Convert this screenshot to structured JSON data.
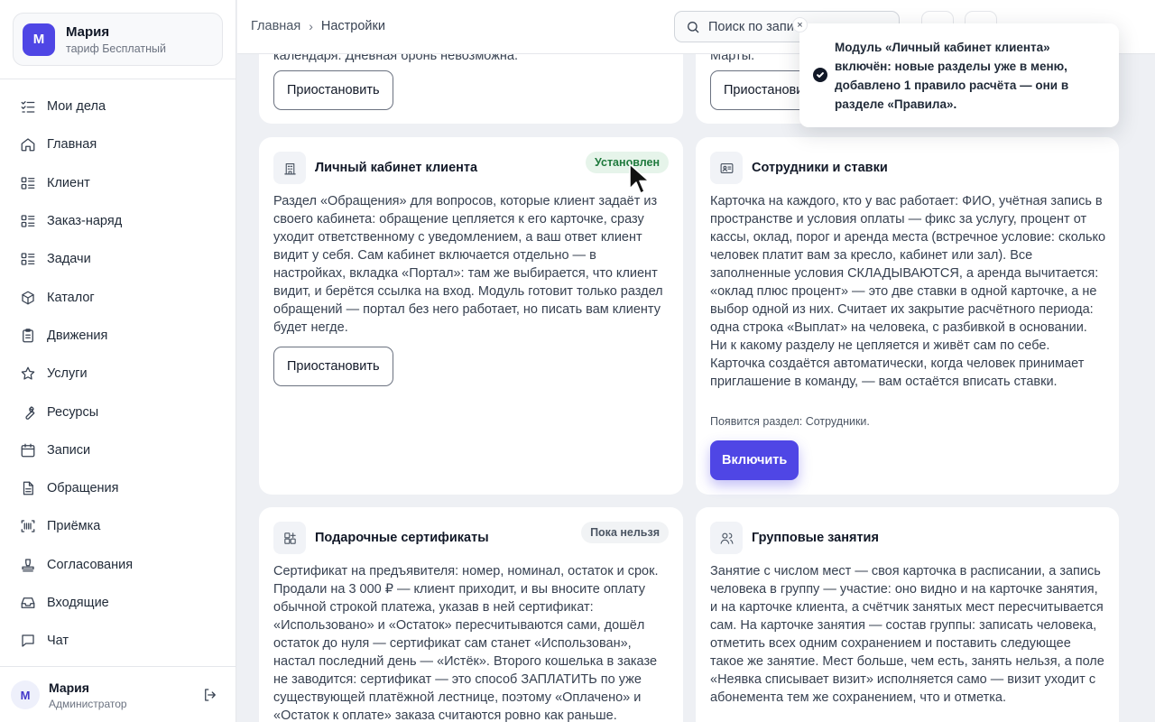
{
  "org": {
    "avatar": "М",
    "name": "Мария",
    "plan": "тариф Бесплатный"
  },
  "nav": [
    {
      "icon": "task-list-icon",
      "label": "Мои дела"
    },
    {
      "icon": "home-icon",
      "label": "Главная"
    },
    {
      "icon": "list-icon",
      "label": "Клиент"
    },
    {
      "icon": "list-icon",
      "label": "Заказ-наряд"
    },
    {
      "icon": "list-icon",
      "label": "Задачи"
    },
    {
      "icon": "box-icon",
      "label": "Каталог"
    },
    {
      "icon": "clipboard-icon",
      "label": "Движения"
    },
    {
      "icon": "star-icon",
      "label": "Услуги"
    },
    {
      "icon": "wrench-icon",
      "label": "Ресурсы"
    },
    {
      "icon": "calendar-icon",
      "label": "Записи"
    },
    {
      "icon": "document-icon",
      "label": "Обращения"
    },
    {
      "icon": "barcode-icon",
      "label": "Приёмка"
    },
    {
      "icon": "stamp-icon",
      "label": "Согласования"
    },
    {
      "icon": "inbox-icon",
      "label": "Входящие"
    },
    {
      "icon": "chat-icon",
      "label": "Чат"
    }
  ],
  "user": {
    "avatar": "М",
    "name": "Мария",
    "role": "Администратор"
  },
  "breadcrumb": {
    "home": "Главная",
    "current": "Настройки"
  },
  "search": {
    "placeholder": "Поиск по запи"
  },
  "top_cards": {
    "left_clipped_text": "календаря. Дневная бронь невозможна.",
    "left_button": "Приостановить",
    "right_clipped_text": "Марты.",
    "right_button": "Приостановить"
  },
  "cards": [
    {
      "icon": "building-icon",
      "title": "Личный кабинет клиента",
      "badge": "Установлен",
      "desc": "Раздел «Обращения» для вопросов, которые клиент задаёт из своего кабинета: обращение цепляется к его карточке, сразу уходит ответственному с уведомлением, а ваш ответ клиент видит у себя. Сам кабинет включается отдельно — в настройках, вкладка «Портал»: там же выбирается, что клиент видит, и берётся ссылка на вход. Модуль готовит только раздел обращений — портал без него работает, но писать вам клиенту будет негде.",
      "button": "Приостановить"
    },
    {
      "icon": "id-card-icon",
      "title": "Сотрудники и ставки",
      "desc": "Карточка на каждого, кто у вас работает: ФИО, учётная запись в пространстве и условия оплаты — фикс за услугу, процент от кассы, оклад, порог и аренда места (встречное условие: сколько человек платит вам за кресло, кабинет или зал). Все заполненные условия СКЛАДЫВАЮТСЯ, а аренда вычитается: «оклад плюс процент» — это две ставки в одной карточке, а не выбор одной из них. Считает их закрытие расчётного периода: одна строка «Выплат» на человека, с разбивкой в основании. Ни к какому разделу не цепляется и живёт сам по себе. Карточка создаётся автоматически, когда человек принимает приглашение в команду, — вам остаётся вписать ставки.",
      "hint": "Появится раздел: Сотрудники.",
      "button": "Включить"
    },
    {
      "icon": "gift-icon",
      "title": "Подарочные сертификаты",
      "badge": "Пока нельзя",
      "desc": "Сертификат на предъявителя: номер, номинал, остаток и срок. Продали на 3 000 ₽ — клиент приходит, и вы вносите оплату обычной строкой платежа, указав в ней сертификат: «Использовано» и «Остаток» пересчитываются сами, дошёл остаток до нуля — сертификат сам станет «Использован», настал последний день — «Истёк». Второго кошелька в заказе не заводится: сертификат — это способ ЗАПЛАТИТЬ по уже существующей платёжной лестнице, поэтому «Оплачено» и «Остаток к оплате» заказа считаются ровно как раньше."
    },
    {
      "icon": "users-icon",
      "title": "Групповые занятия",
      "desc": "Занятие с числом мест — своя карточка в расписании, а запись человека в группу — участие: оно видно и на карточке занятия, и на карточке клиента, а счётчик занятых мест пересчитывается сам. На карточке занятия — состав группы: записать человека, отметить всех одним сохранением и поставить следующее такое же занятие. Мест больше, чем есть, занять нельзя, а поле «Неявка списывает визит» исполняется само — визит уходит с абонемента тем же сохранением, что и отметка."
    }
  ],
  "toast": {
    "message": "Модуль «Личный кабинет клиента» включён: новые разделы уже в меню, добавлено 1 правило расчёта — они в разделе «Правила».",
    "close": "×"
  }
}
